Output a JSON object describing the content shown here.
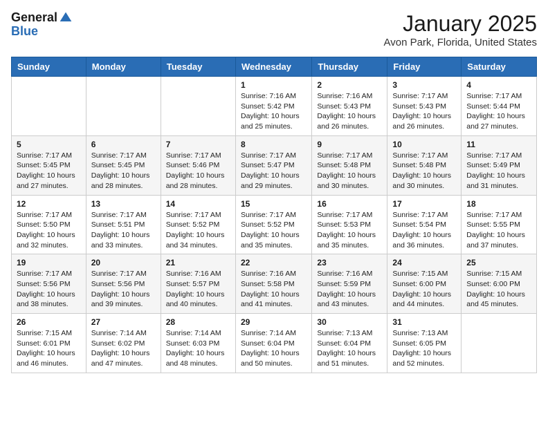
{
  "header": {
    "logo_general": "General",
    "logo_blue": "Blue",
    "month_title": "January 2025",
    "location": "Avon Park, Florida, United States"
  },
  "days_of_week": [
    "Sunday",
    "Monday",
    "Tuesday",
    "Wednesday",
    "Thursday",
    "Friday",
    "Saturday"
  ],
  "weeks": [
    [
      {
        "day": "",
        "content": ""
      },
      {
        "day": "",
        "content": ""
      },
      {
        "day": "",
        "content": ""
      },
      {
        "day": "1",
        "content": "Sunrise: 7:16 AM\nSunset: 5:42 PM\nDaylight: 10 hours\nand 25 minutes."
      },
      {
        "day": "2",
        "content": "Sunrise: 7:16 AM\nSunset: 5:43 PM\nDaylight: 10 hours\nand 26 minutes."
      },
      {
        "day": "3",
        "content": "Sunrise: 7:17 AM\nSunset: 5:43 PM\nDaylight: 10 hours\nand 26 minutes."
      },
      {
        "day": "4",
        "content": "Sunrise: 7:17 AM\nSunset: 5:44 PM\nDaylight: 10 hours\nand 27 minutes."
      }
    ],
    [
      {
        "day": "5",
        "content": "Sunrise: 7:17 AM\nSunset: 5:45 PM\nDaylight: 10 hours\nand 27 minutes."
      },
      {
        "day": "6",
        "content": "Sunrise: 7:17 AM\nSunset: 5:45 PM\nDaylight: 10 hours\nand 28 minutes."
      },
      {
        "day": "7",
        "content": "Sunrise: 7:17 AM\nSunset: 5:46 PM\nDaylight: 10 hours\nand 28 minutes."
      },
      {
        "day": "8",
        "content": "Sunrise: 7:17 AM\nSunset: 5:47 PM\nDaylight: 10 hours\nand 29 minutes."
      },
      {
        "day": "9",
        "content": "Sunrise: 7:17 AM\nSunset: 5:48 PM\nDaylight: 10 hours\nand 30 minutes."
      },
      {
        "day": "10",
        "content": "Sunrise: 7:17 AM\nSunset: 5:48 PM\nDaylight: 10 hours\nand 30 minutes."
      },
      {
        "day": "11",
        "content": "Sunrise: 7:17 AM\nSunset: 5:49 PM\nDaylight: 10 hours\nand 31 minutes."
      }
    ],
    [
      {
        "day": "12",
        "content": "Sunrise: 7:17 AM\nSunset: 5:50 PM\nDaylight: 10 hours\nand 32 minutes."
      },
      {
        "day": "13",
        "content": "Sunrise: 7:17 AM\nSunset: 5:51 PM\nDaylight: 10 hours\nand 33 minutes."
      },
      {
        "day": "14",
        "content": "Sunrise: 7:17 AM\nSunset: 5:52 PM\nDaylight: 10 hours\nand 34 minutes."
      },
      {
        "day": "15",
        "content": "Sunrise: 7:17 AM\nSunset: 5:52 PM\nDaylight: 10 hours\nand 35 minutes."
      },
      {
        "day": "16",
        "content": "Sunrise: 7:17 AM\nSunset: 5:53 PM\nDaylight: 10 hours\nand 35 minutes."
      },
      {
        "day": "17",
        "content": "Sunrise: 7:17 AM\nSunset: 5:54 PM\nDaylight: 10 hours\nand 36 minutes."
      },
      {
        "day": "18",
        "content": "Sunrise: 7:17 AM\nSunset: 5:55 PM\nDaylight: 10 hours\nand 37 minutes."
      }
    ],
    [
      {
        "day": "19",
        "content": "Sunrise: 7:17 AM\nSunset: 5:56 PM\nDaylight: 10 hours\nand 38 minutes."
      },
      {
        "day": "20",
        "content": "Sunrise: 7:17 AM\nSunset: 5:56 PM\nDaylight: 10 hours\nand 39 minutes."
      },
      {
        "day": "21",
        "content": "Sunrise: 7:16 AM\nSunset: 5:57 PM\nDaylight: 10 hours\nand 40 minutes."
      },
      {
        "day": "22",
        "content": "Sunrise: 7:16 AM\nSunset: 5:58 PM\nDaylight: 10 hours\nand 41 minutes."
      },
      {
        "day": "23",
        "content": "Sunrise: 7:16 AM\nSunset: 5:59 PM\nDaylight: 10 hours\nand 43 minutes."
      },
      {
        "day": "24",
        "content": "Sunrise: 7:15 AM\nSunset: 6:00 PM\nDaylight: 10 hours\nand 44 minutes."
      },
      {
        "day": "25",
        "content": "Sunrise: 7:15 AM\nSunset: 6:00 PM\nDaylight: 10 hours\nand 45 minutes."
      }
    ],
    [
      {
        "day": "26",
        "content": "Sunrise: 7:15 AM\nSunset: 6:01 PM\nDaylight: 10 hours\nand 46 minutes."
      },
      {
        "day": "27",
        "content": "Sunrise: 7:14 AM\nSunset: 6:02 PM\nDaylight: 10 hours\nand 47 minutes."
      },
      {
        "day": "28",
        "content": "Sunrise: 7:14 AM\nSunset: 6:03 PM\nDaylight: 10 hours\nand 48 minutes."
      },
      {
        "day": "29",
        "content": "Sunrise: 7:14 AM\nSunset: 6:04 PM\nDaylight: 10 hours\nand 50 minutes."
      },
      {
        "day": "30",
        "content": "Sunrise: 7:13 AM\nSunset: 6:04 PM\nDaylight: 10 hours\nand 51 minutes."
      },
      {
        "day": "31",
        "content": "Sunrise: 7:13 AM\nSunset: 6:05 PM\nDaylight: 10 hours\nand 52 minutes."
      },
      {
        "day": "",
        "content": ""
      }
    ]
  ]
}
